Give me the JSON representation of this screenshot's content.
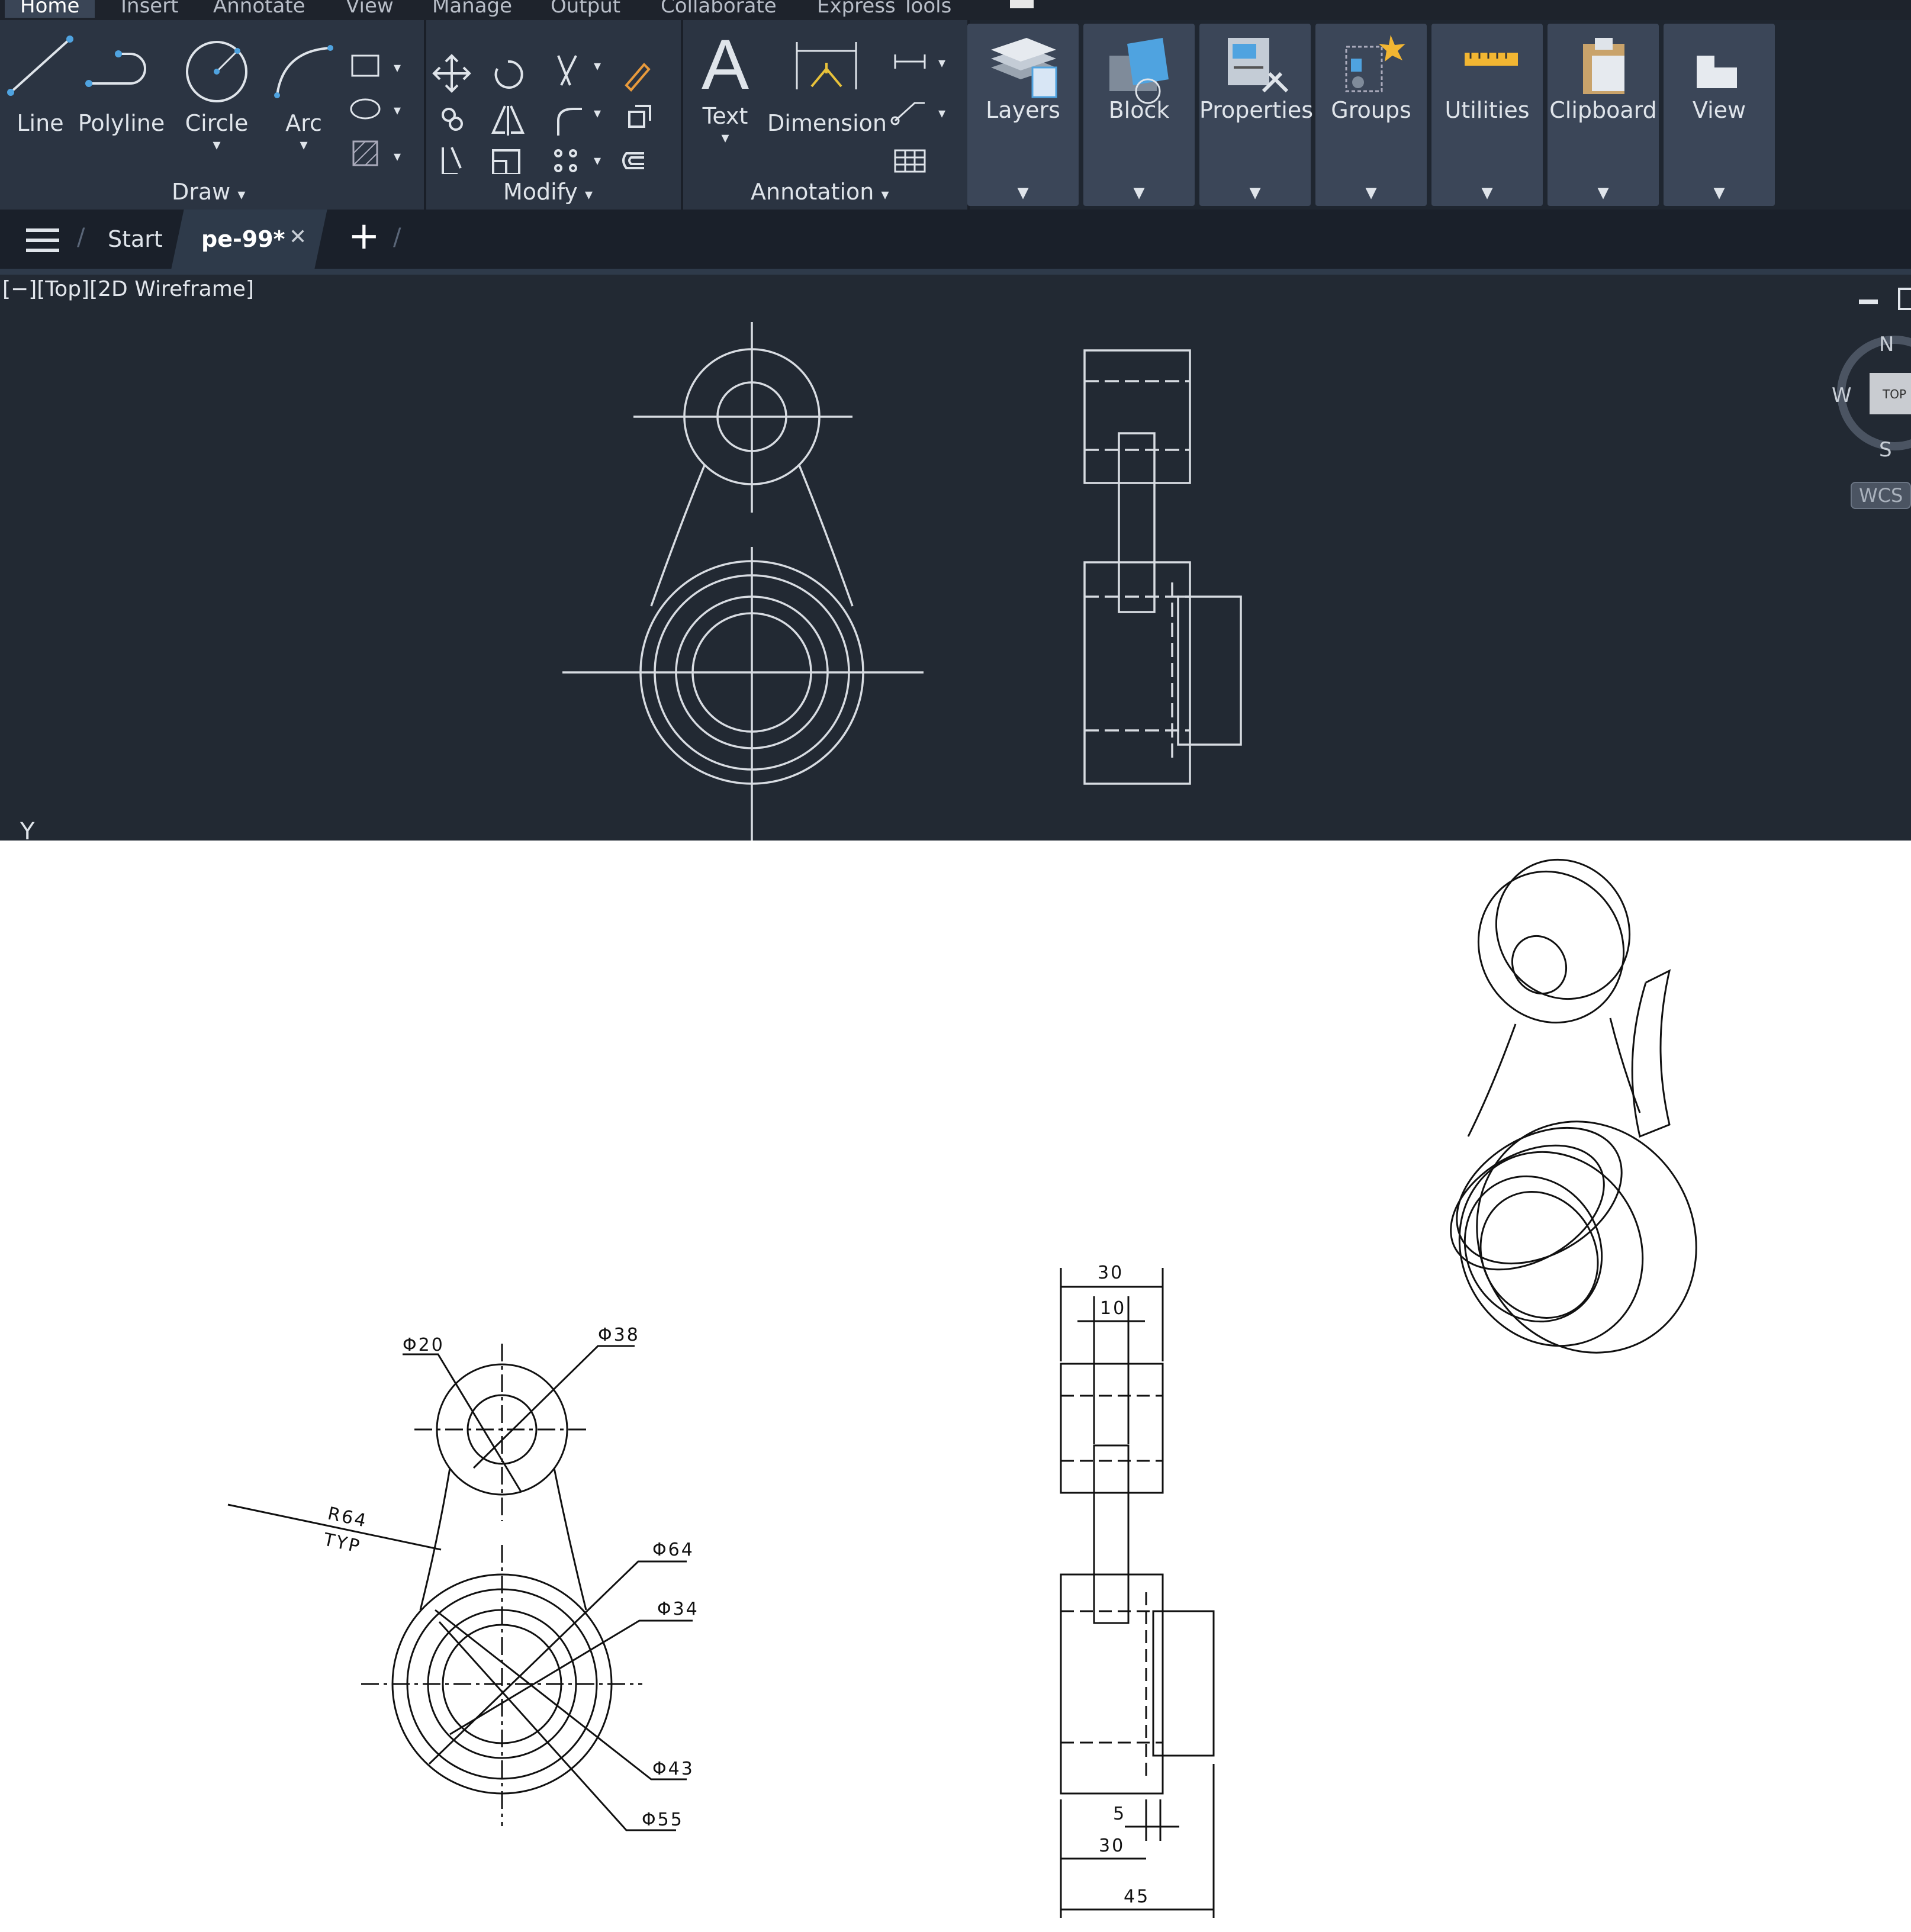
{
  "menu": {
    "tabs": [
      "Home",
      "Insert",
      "Annotate",
      "View",
      "Manage",
      "Output",
      "Collaborate",
      "Express Tools"
    ]
  },
  "ribbon": {
    "draw_tools": [
      "Line",
      "Polyline",
      "Circle",
      "Arc"
    ],
    "panel_titles": {
      "draw": "Draw",
      "modify": "Modify",
      "annotation": "Annotation"
    },
    "annotation_tools": [
      "Text",
      "Dimension"
    ],
    "big_tools": [
      "Layers",
      "Block",
      "Properties",
      "Groups",
      "Utilities",
      "Clipboard",
      "View"
    ]
  },
  "file_tabs": {
    "start": "Start",
    "active": "pe-99*",
    "close_glyph": "✕",
    "new_glyph": "+"
  },
  "viewport": {
    "label": "[−][Top][2D Wireframe]",
    "viewcube_face": "TOP",
    "compass": {
      "n": "N",
      "s": "S",
      "w": "W"
    },
    "wcs": "WCS",
    "axis_label": "Y"
  },
  "drawing": {
    "front_view_dims": {
      "d20": "Φ20",
      "d38": "Φ38",
      "r64": "R64",
      "typ": "TYP",
      "d64": "Φ64",
      "d34": "Φ34",
      "d43": "Φ43",
      "d55": "Φ55"
    },
    "side_view_dims": {
      "w30_top": "30",
      "w10": "10",
      "w5": "5",
      "w30_bottom": "30",
      "w45": "45"
    }
  },
  "colors": {
    "ribbon_bg": "#1f2630",
    "panel_bg": "#2b3442",
    "viewport_bg": "#222933",
    "cad_line": "#d8dce2",
    "paper": "#ffffff"
  }
}
